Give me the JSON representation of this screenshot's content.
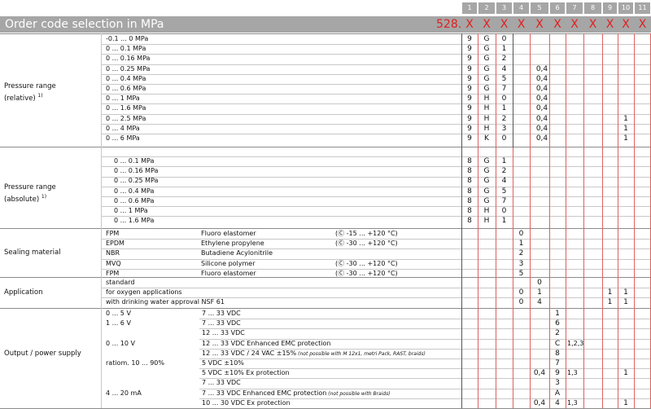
{
  "header": {
    "title": "Order code selection in MPa",
    "code_prefix": "528.",
    "column_numbers": [
      "1",
      "2",
      "3",
      "4",
      "5",
      "6",
      "7",
      "8",
      "9",
      "10",
      "11"
    ],
    "placeholders": [
      "X",
      "X",
      "X",
      "X",
      "X",
      "X",
      "X",
      "X",
      "X",
      "X",
      "X"
    ]
  },
  "groups": [
    {
      "label_line1": "Pressure range",
      "label_line2": "(relative)",
      "footnote": "1)"
    },
    {
      "label_line1": "Pressure range",
      "label_line2": "(absolute)",
      "footnote": "1)"
    },
    {
      "label_line1": "Sealing material",
      "label_line2": "",
      "footnote": ""
    },
    {
      "label_line1": "Application",
      "label_line2": "",
      "footnote": ""
    },
    {
      "label_line1": "Output / power supply",
      "label_line2": "",
      "footnote": ""
    }
  ],
  "relative_rows": [
    {
      "range": "-0.1 ...     0 MPa",
      "c1": "9",
      "c2": "G",
      "c3": "0",
      "c5": "",
      "c10": ""
    },
    {
      "range": "0 ...   0.1 MPa",
      "c1": "9",
      "c2": "G",
      "c3": "1",
      "c5": "",
      "c10": ""
    },
    {
      "range": "0 ... 0.16 MPa",
      "c1": "9",
      "c2": "G",
      "c3": "2",
      "c5": "",
      "c10": ""
    },
    {
      "range": "0 ... 0.25 MPa",
      "c1": "9",
      "c2": "G",
      "c3": "4",
      "c5": "0,4",
      "c10": ""
    },
    {
      "range": "0 ...   0.4 MPa",
      "c1": "9",
      "c2": "G",
      "c3": "5",
      "c5": "0,4",
      "c10": ""
    },
    {
      "range": "0 ...   0.6 MPa",
      "c1": "9",
      "c2": "G",
      "c3": "7",
      "c5": "0,4",
      "c10": ""
    },
    {
      "range": "0 ...      1 MPa",
      "c1": "9",
      "c2": "H",
      "c3": "0",
      "c5": "0,4",
      "c10": ""
    },
    {
      "range": "0 ...   1.6 MPa",
      "c1": "9",
      "c2": "H",
      "c3": "1",
      "c5": "0,4",
      "c10": ""
    },
    {
      "range": "0 ...   2.5 MPa",
      "c1": "9",
      "c2": "H",
      "c3": "2",
      "c5": "0,4",
      "c10": "1"
    },
    {
      "range": "0 ...      4 MPa",
      "c1": "9",
      "c2": "H",
      "c3": "3",
      "c5": "0,4",
      "c10": "1"
    },
    {
      "range": "0 ...      6 MPa",
      "c1": "9",
      "c2": "K",
      "c3": "0",
      "c5": "0,4",
      "c10": "1"
    }
  ],
  "absolute_rows": [
    {
      "range": "0 ...   0.1 MPa",
      "c1": "8",
      "c2": "G",
      "c3": "1"
    },
    {
      "range": "0 ... 0.16 MPa",
      "c1": "8",
      "c2": "G",
      "c3": "2"
    },
    {
      "range": "0 ... 0.25 MPa",
      "c1": "8",
      "c2": "G",
      "c3": "4"
    },
    {
      "range": "0 ...   0.4 MPa",
      "c1": "8",
      "c2": "G",
      "c3": "5"
    },
    {
      "range": "0 ...   0.6 MPa",
      "c1": "8",
      "c2": "G",
      "c3": "7"
    },
    {
      "range": "0 ...      1 MPa",
      "c1": "8",
      "c2": "H",
      "c3": "0"
    },
    {
      "range": "0 ...   1.6 MPa",
      "c1": "8",
      "c2": "H",
      "c3": "1"
    }
  ],
  "sealing_rows": [
    {
      "code": "FPM",
      "name": "Fluoro elastomer",
      "temp": "-15 ... +120 °C",
      "c4": "0"
    },
    {
      "code": "EPDM",
      "name": "Ethylene propylene",
      "temp": "-30 ... +120 °C",
      "c4": "1"
    },
    {
      "code": "NBR",
      "name": "Butadiene Acylonitrile",
      "temp": "",
      "c4": "2"
    },
    {
      "code": "MVQ",
      "name": "Silicone polymer",
      "temp": "-30 ... +120 °C",
      "c4": "3"
    },
    {
      "code": "FPM",
      "name": "Fluoro elastomer",
      "temp": "-30 ... +120 °C",
      "c4": "5"
    }
  ],
  "application_rows": [
    {
      "text": "standard",
      "c4": "",
      "c5": "0",
      "c9": "",
      "c10": ""
    },
    {
      "text": "for oxygen applications",
      "c4": "0",
      "c5": "1",
      "c9": "1",
      "c10": "1"
    },
    {
      "text": "with drinking water approval NSF 61",
      "c4": "0",
      "c5": "4",
      "c9": "1",
      "c10": "1"
    }
  ],
  "output_rows": [
    {
      "out": "0 ...   5 V",
      "supply": "7 ... 33 VDC",
      "note": "",
      "c5": "",
      "c6": "1",
      "c7": "",
      "c10": ""
    },
    {
      "out": "1 ...   6 V",
      "supply": "7 ... 33 VDC",
      "note": "",
      "c5": "",
      "c6": "6",
      "c7": "",
      "c10": ""
    },
    {
      "out": "",
      "supply": "12 ... 33 VDC",
      "note": "",
      "c5": "",
      "c6": "2",
      "c7": "",
      "c10": ""
    },
    {
      "out": "0 ... 10 V",
      "supply": "12 ... 33 VDC Enhanced EMC protection",
      "note": "",
      "c5": "",
      "c6": "C",
      "c7": "1,2,3",
      "c10": ""
    },
    {
      "out": "",
      "supply": "12 ... 33 VDC / 24 VAC ±15%",
      "note": "(not possible with M 12x1, metri Pack, RAST, braids)",
      "c5": "",
      "c6": "8",
      "c7": "",
      "c10": ""
    },
    {
      "out": "ratiom. 10 ... 90%",
      "supply": "5 VDC ±10%",
      "note": "",
      "c5": "",
      "c6": "7",
      "c7": "",
      "c10": ""
    },
    {
      "out": "",
      "supply": "5 VDC ±10% Ex protection",
      "note": "",
      "c5": "0,4",
      "c6": "9",
      "c7": "1,3",
      "c10": "1"
    },
    {
      "out": "",
      "supply": "7 ... 33 VDC",
      "note": "",
      "c5": "",
      "c6": "3",
      "c7": "",
      "c10": ""
    },
    {
      "out": "4 ... 20 mA",
      "supply": "7 ... 33 VDC Enhanced EMC protection",
      "note": "(not possible with Braids)",
      "c5": "",
      "c6": "A",
      "c7": "",
      "c10": ""
    },
    {
      "out": "",
      "supply": "10 ... 30 VDC Ex protection",
      "note": "",
      "c5": "0,4",
      "c6": "4",
      "c7": "1,3",
      "c10": "1"
    }
  ],
  "colors": {
    "header_bg": "#a6a6a6",
    "accent_red": "#e02020",
    "grid_red": "#e06060"
  }
}
